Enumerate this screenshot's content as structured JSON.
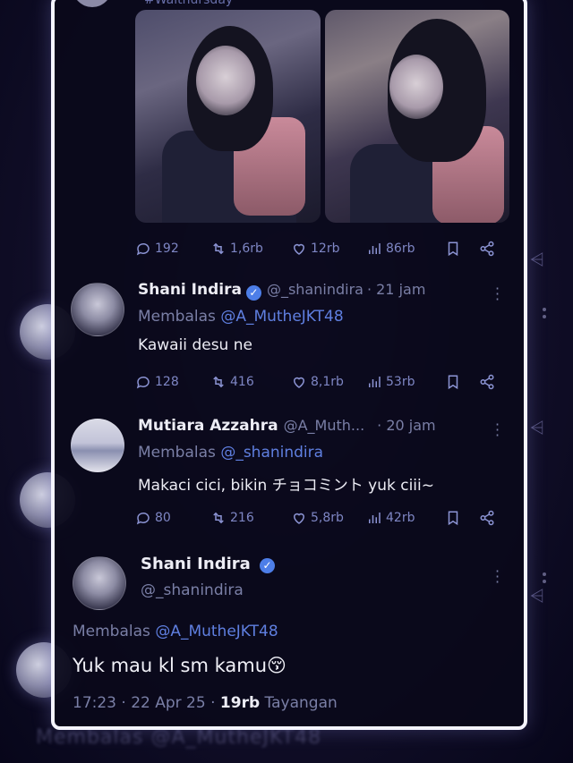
{
  "top": {
    "partial_text": "#Waithursday"
  },
  "media_post": {
    "metrics": {
      "replies": "192",
      "reposts": "1,6rb",
      "likes": "12rb",
      "views": "86rb"
    }
  },
  "replies": [
    {
      "name": "Shani Indira",
      "handle": "@_shanindira",
      "time": "· 21 jam",
      "replying_prefix": "Membalas",
      "replying_to": "@A_MutheJKT48",
      "text": "Kawaii desu ne",
      "metrics": {
        "replies": "128",
        "reposts": "416",
        "likes": "8,1rb",
        "views": "53rb"
      }
    },
    {
      "name": "Mutiara Azzahra",
      "handle": "@A_Muth...",
      "time": "· 20 jam",
      "replying_prefix": "Membalas",
      "replying_to": "@_shanindira",
      "text": "Makaci cici, bikin チョコミント yuk ciii~",
      "metrics": {
        "replies": "80",
        "reposts": "216",
        "likes": "5,8rb",
        "views": "42rb"
      }
    }
  ],
  "main_post": {
    "name": "Shani Indira",
    "handle": "@_shanindira",
    "replying_prefix": "Membalas",
    "replying_to": "@A_MutheJKT48",
    "text": "Yuk mau kl sm kamu😚",
    "timestamp": "17:23 · 22 Apr 25 ·",
    "views_count": "19rb",
    "views_label": "Tayangan"
  },
  "background": {
    "bottom_text": "Membalas @A_MutheJKT48"
  },
  "icons": [
    "reply-icon",
    "repost-icon",
    "like-icon",
    "views-icon",
    "bookmark-icon",
    "share-icon",
    "verified-icon",
    "more-icon"
  ],
  "colors": {
    "accent": "#4d7ee8",
    "mention": "#5f7fe0",
    "muted": "#7a7fa6",
    "frame": "#f4f4ff"
  }
}
